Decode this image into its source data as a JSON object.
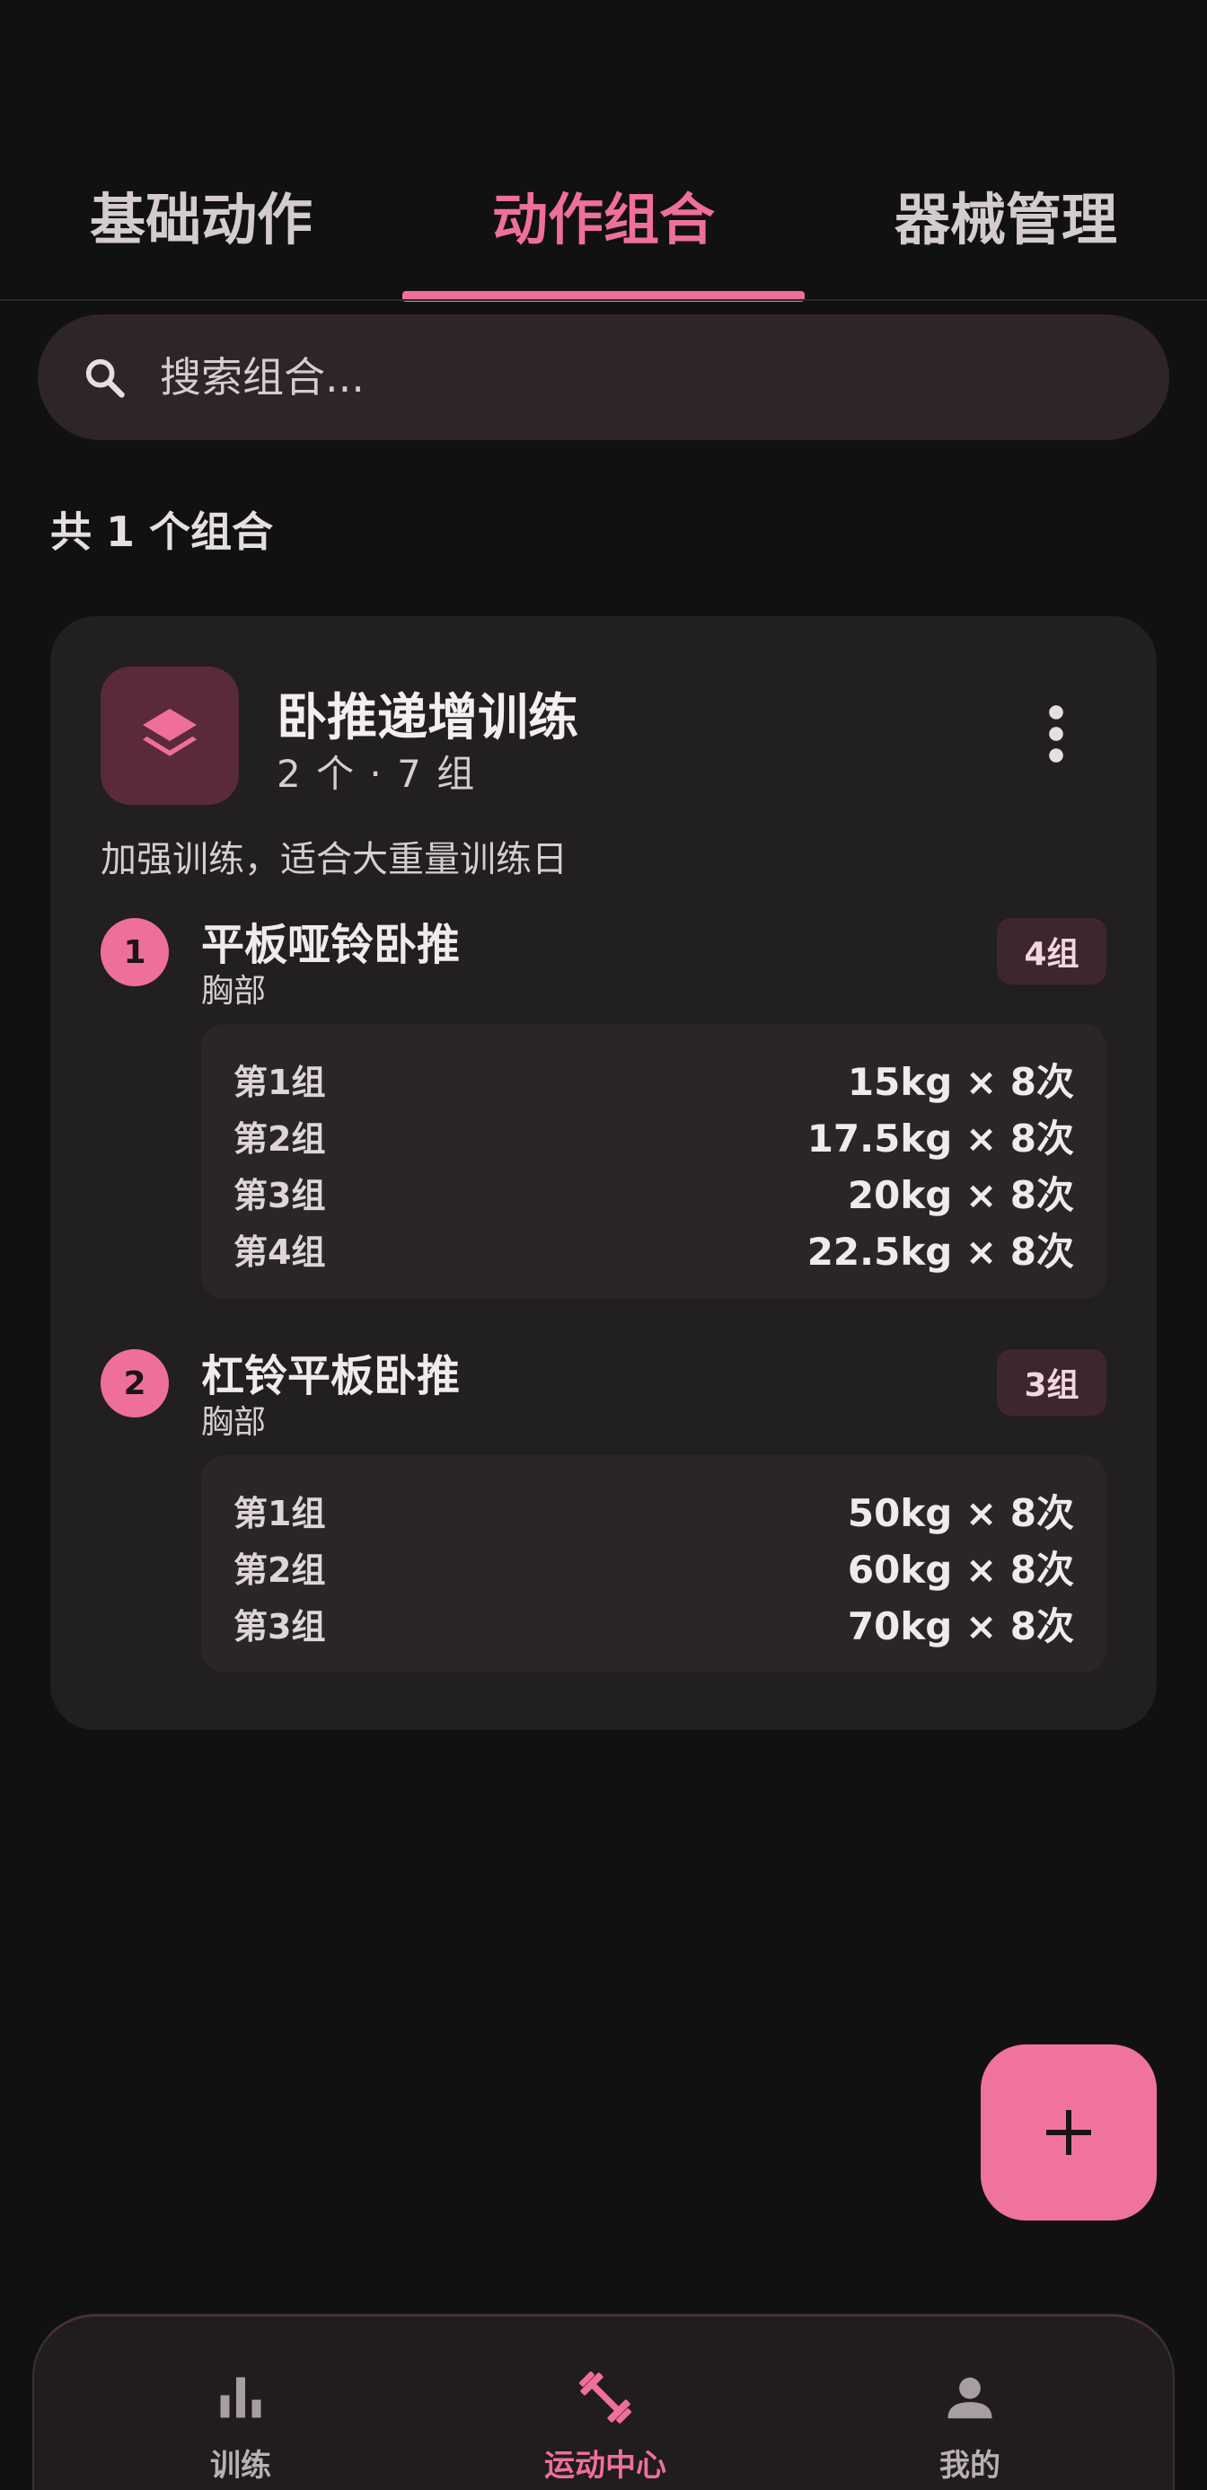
{
  "tabs": [
    {
      "label": "基础动作",
      "active": false
    },
    {
      "label": "动作组合",
      "active": true
    },
    {
      "label": "器械管理",
      "active": false
    }
  ],
  "search": {
    "placeholder": "搜索组合..."
  },
  "summary": {
    "count_text": "共 1 个组合"
  },
  "combo": {
    "title": "卧推递增训练",
    "subtitle": "2 个 · 7 组",
    "description": "加强训练，适合大重量训练日",
    "icon": "layers-icon",
    "exercises": [
      {
        "number": "1",
        "name": "平板哑铃卧推",
        "body_part": "胸部",
        "badge": "4组",
        "sets": [
          {
            "label": "第1组",
            "value": "15kg × 8次"
          },
          {
            "label": "第2组",
            "value": "17.5kg × 8次"
          },
          {
            "label": "第3组",
            "value": "20kg × 8次"
          },
          {
            "label": "第4组",
            "value": "22.5kg × 8次"
          }
        ]
      },
      {
        "number": "2",
        "name": "杠铃平板卧推",
        "body_part": "胸部",
        "badge": "3组",
        "sets": [
          {
            "label": "第1组",
            "value": "50kg × 8次"
          },
          {
            "label": "第2组",
            "value": "60kg × 8次"
          },
          {
            "label": "第3组",
            "value": "70kg × 8次"
          }
        ]
      }
    ]
  },
  "fab": {
    "icon": "plus-icon"
  },
  "bottom_nav": [
    {
      "label": "训练",
      "icon": "bar-chart-icon",
      "active": false
    },
    {
      "label": "运动中心",
      "icon": "dumbbell-icon",
      "active": true
    },
    {
      "label": "我的",
      "icon": "person-icon",
      "active": false
    }
  ],
  "colors": {
    "accent": "#ef6f9c",
    "background": "#121112",
    "card": "#211f20"
  }
}
